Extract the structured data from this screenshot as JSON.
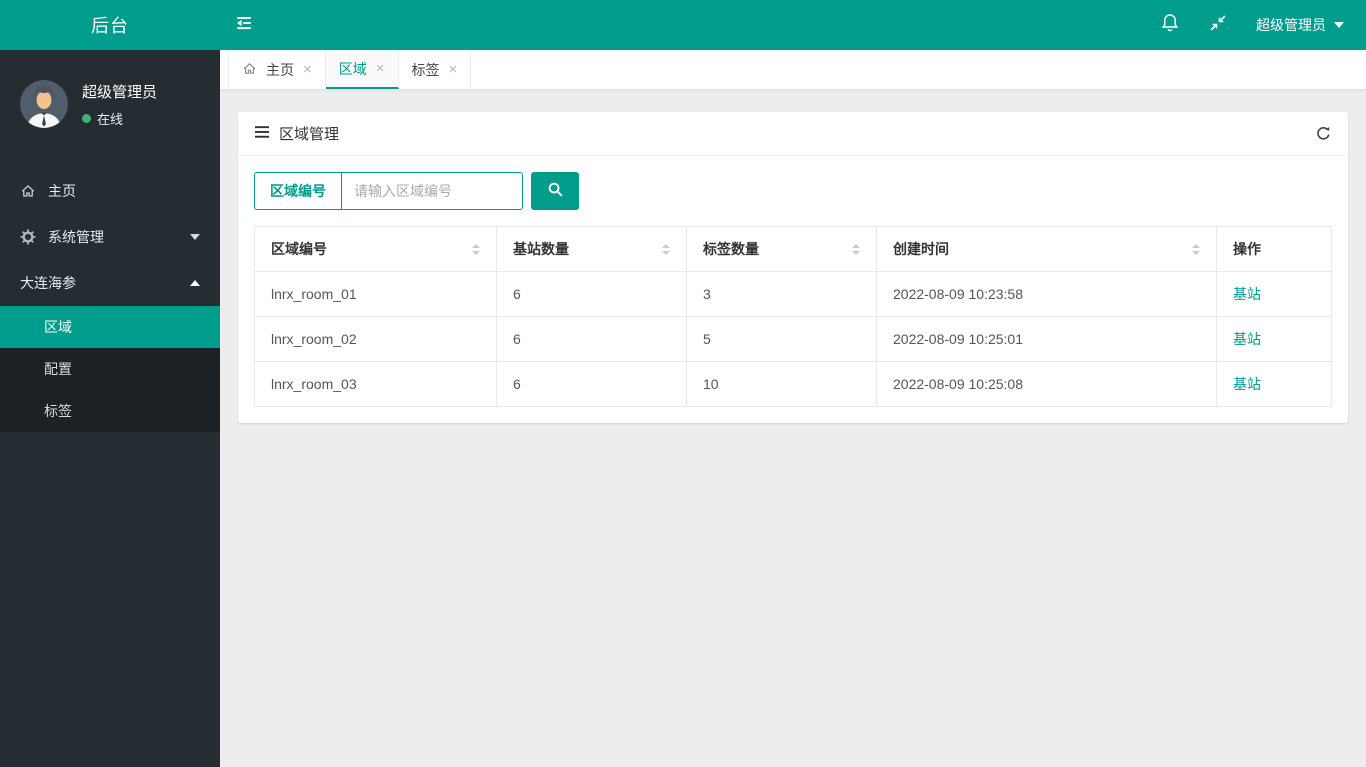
{
  "theme": {
    "accent_teal": "#009C8C",
    "sidebar_bg": "#252D33",
    "submenu_bg": "#1B2125",
    "online_green": "#3CB371",
    "content_bg": "#EDEDED"
  },
  "topbar": {
    "logo": "后台",
    "user_menu": {
      "label": "超级管理员"
    }
  },
  "sidebar": {
    "user": {
      "name": "超级管理员",
      "status": "在线"
    },
    "menu": [
      {
        "label": "主页"
      },
      {
        "label": "系统管理"
      },
      {
        "label": "大连海参"
      }
    ],
    "submenu": [
      {
        "label": "区域",
        "active": true
      },
      {
        "label": "配置"
      },
      {
        "label": "标签"
      }
    ]
  },
  "tabs": [
    {
      "label": "主页"
    },
    {
      "label": "区域",
      "active": true
    },
    {
      "label": "标签"
    }
  ],
  "panel": {
    "title": "区域管理",
    "search": {
      "field_label": "区域编号",
      "placeholder": "请输入区域编号"
    },
    "table": {
      "columns": [
        {
          "label": "区域编号",
          "sortable": true
        },
        {
          "label": "基站数量",
          "sortable": true
        },
        {
          "label": "标签数量",
          "sortable": true
        },
        {
          "label": "创建时间",
          "sortable": true
        },
        {
          "label": "操作",
          "sortable": false
        }
      ],
      "rows": [
        {
          "area_id": "lnrx_room_01",
          "stations": "6",
          "tags": "3",
          "created": "2022-08-09 10:23:58",
          "action": "基站"
        },
        {
          "area_id": "lnrx_room_02",
          "stations": "6",
          "tags": "5",
          "created": "2022-08-09 10:25:01",
          "action": "基站"
        },
        {
          "area_id": "lnrx_room_03",
          "stations": "6",
          "tags": "10",
          "created": "2022-08-09 10:25:08",
          "action": "基站"
        }
      ]
    }
  },
  "icons": {
    "close": "×"
  }
}
